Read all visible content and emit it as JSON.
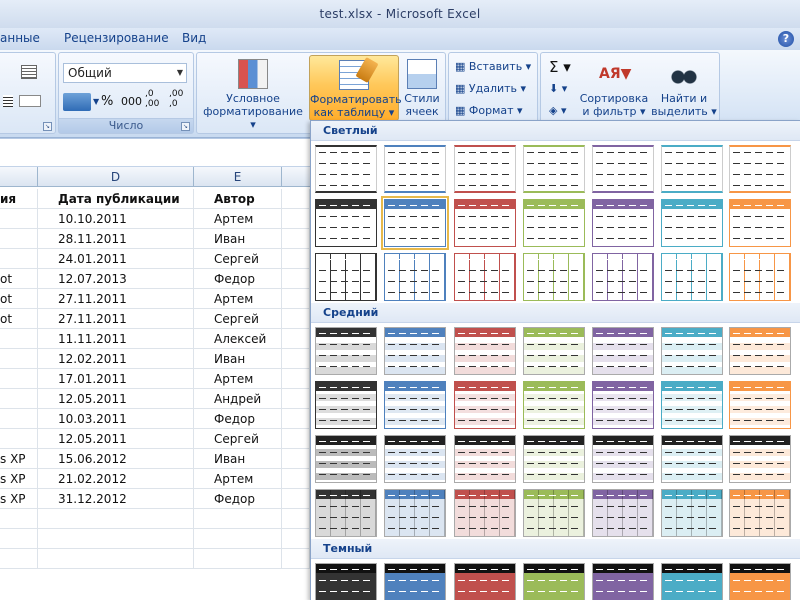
{
  "window": {
    "title": "test.xlsx - Microsoft Excel"
  },
  "tabs": [
    "анные",
    "Рецензирование",
    "Вид"
  ],
  "help_label": "?",
  "ribbon": {
    "number_format": "Общий",
    "number_group_label": "Число",
    "percent": "%",
    "thousands": "000",
    "inc_dec": ",0 ,00",
    "dec_dec": ",00 ,0",
    "cond_format": [
      "Условное",
      "форматирование"
    ],
    "format_table": [
      "Форматировать",
      "как таблицу"
    ],
    "cell_styles": [
      "Стили",
      "ячеек"
    ],
    "insert": "Вставить",
    "delete": "Удалить",
    "format": "Формат",
    "sort_filter": [
      "Сортировка",
      "и фильтр"
    ],
    "find_select": [
      "Найти и",
      "выделить"
    ],
    "sigma": "Σ"
  },
  "sheet": {
    "columns": [
      "D",
      "E"
    ],
    "headers": {
      "c": "ия",
      "d": "Дата публикации",
      "e": "Автор"
    },
    "rows": [
      {
        "c": "",
        "d": "10.10.2011",
        "e": "Артем"
      },
      {
        "c": "",
        "d": "28.11.2011",
        "e": "Иван"
      },
      {
        "c": "",
        "d": "24.01.2011",
        "e": "Сергей"
      },
      {
        "c": "ot",
        "d": "12.07.2013",
        "e": "Федор"
      },
      {
        "c": "ot",
        "d": "27.11.2011",
        "e": "Артем"
      },
      {
        "c": "ot",
        "d": "27.11.2011",
        "e": "Сергей"
      },
      {
        "c": "",
        "d": "11.11.2011",
        "e": "Алексей"
      },
      {
        "c": "",
        "d": "12.02.2011",
        "e": "Иван"
      },
      {
        "c": "",
        "d": "17.01.2011",
        "e": "Артем"
      },
      {
        "c": "",
        "d": "12.05.2011",
        "e": "Андрей"
      },
      {
        "c": "",
        "d": "10.03.2011",
        "e": "Федор"
      },
      {
        "c": "",
        "d": "12.05.2011",
        "e": "Сергей"
      },
      {
        "c": "s XP",
        "d": "15.06.2012",
        "e": "Иван"
      },
      {
        "c": "s XP",
        "d": "21.02.2012",
        "e": "Артем"
      },
      {
        "c": "s XP",
        "d": "31.12.2012",
        "e": "Федор"
      }
    ]
  },
  "gallery": {
    "sections": [
      "Светлый",
      "Средний",
      "Темный"
    ],
    "colors": [
      "#333333",
      "#4f81bd",
      "#c0504d",
      "#9bbb59",
      "#8064a2",
      "#4bacc6",
      "#f79646"
    ],
    "light_tints": [
      "#d9d9d9",
      "#dbe5f1",
      "#f2dcdb",
      "#ebf1de",
      "#e5e0ec",
      "#dbeef3",
      "#fde9d9"
    ]
  }
}
